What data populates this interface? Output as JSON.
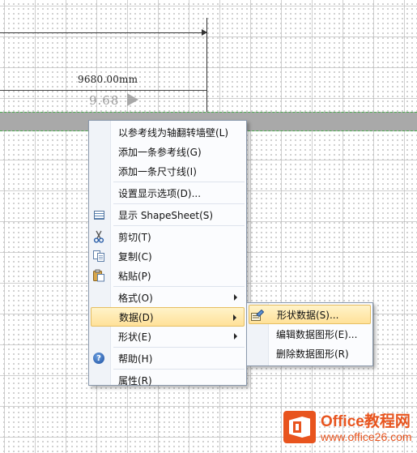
{
  "canvas": {
    "dimension_text": "9680.00mm",
    "tooltip_value": "9.68"
  },
  "context_menu": {
    "items": [
      {
        "label": "以参考线为轴翻转墙壁(L)"
      },
      {
        "label": "添加一条参考线(G)"
      },
      {
        "label": "添加一条尺寸线(I)"
      },
      {
        "label": "设置显示选项(D)..."
      },
      {
        "label": "显示 ShapeSheet(S)",
        "icon": "shapesheet-icon"
      },
      {
        "label": "剪切(T)",
        "icon": "scissors-icon"
      },
      {
        "label": "复制(C)",
        "icon": "copy-icon"
      },
      {
        "label": "粘贴(P)",
        "icon": "paste-icon"
      },
      {
        "label": "格式(O)"
      },
      {
        "label": "数据(D)"
      },
      {
        "label": "形状(E)"
      },
      {
        "label": "帮助(H)",
        "icon": "help-icon"
      },
      {
        "label": "属性(R)"
      }
    ]
  },
  "submenu": {
    "items": [
      {
        "label": "形状数据(S)...",
        "icon": "shape-data-icon"
      },
      {
        "label": "编辑数据图形(E)..."
      },
      {
        "label": "删除数据图形(R)"
      }
    ]
  },
  "watermark": {
    "brand": "Office教程网",
    "url": "www.office26.com"
  },
  "colors": {
    "highlight": "#ffe199",
    "menu_border": "#8a99ad",
    "wall": "#a9a9a9",
    "brand": "#e8541e"
  }
}
